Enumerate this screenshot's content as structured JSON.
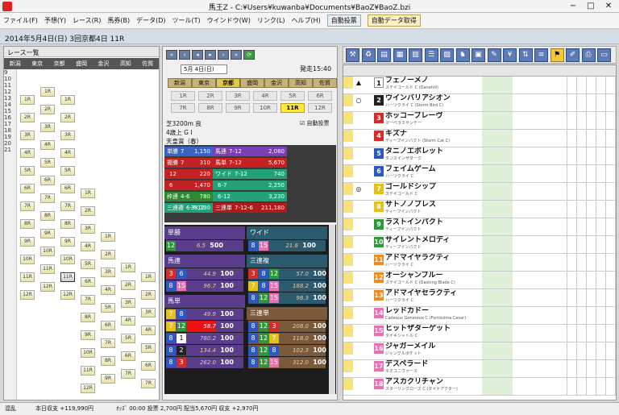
{
  "window": {
    "title": "馬王Z - C:¥Users¥kuwanba¥Documents¥BaoZ¥BaoZ.bzi",
    "min": "−",
    "max": "□",
    "close": "✕"
  },
  "menu": [
    "ファイル(F)",
    "予想(Y)",
    "レース(R)",
    "馬券(B)",
    "データ(D)",
    "ツール(T)",
    "ウインドウ(W)",
    "リンク(L)",
    "ヘルプ(H)"
  ],
  "toolbar": {
    "auto_vote": "自動投票",
    "auto_data": "自動データ取得"
  },
  "date_line": "2014年5月4日(日) 3回京都4日 11R",
  "race_list": {
    "title": "レース一覧",
    "courses": [
      "新潟",
      "東京",
      "京都",
      "盛岡",
      "金沢",
      "高知",
      "佐賀"
    ],
    "hours": [
      "9",
      "10",
      "11",
      "12",
      "13",
      "14",
      "15",
      "16",
      "17",
      "18",
      "19",
      "20",
      "21"
    ]
  },
  "center": {
    "nav": [
      "«",
      "‹",
      "◂",
      "▸",
      "›",
      "»",
      "⟳"
    ],
    "date_select": "5月 4日(日)",
    "time": "発走15:40",
    "tracks": [
      "新潟",
      "東京",
      "京都",
      "盛岡",
      "金沢",
      "高知",
      "佐賀"
    ],
    "races": [
      "1R",
      "2R",
      "3R",
      "4R",
      "5R",
      "6R",
      "7R",
      "8R",
      "9R",
      "10R",
      "11R",
      "12R"
    ],
    "selected_race": "11R",
    "info": [
      "芝3200m 良",
      "4歳上 G I",
      "天皇賞（春）"
    ],
    "auto_vote_label": "☑ 自動投票",
    "odds_grid": [
      {
        "label": "単勝",
        "n": "7",
        "val": "1,150",
        "c": "#3b63c4"
      },
      {
        "label": "馬連",
        "n": "7-12",
        "val": "2,080",
        "c": "#7a3fb2"
      },
      {
        "label": "複勝",
        "n": "7",
        "val": "310",
        "c": "#c42222"
      },
      {
        "label": "馬単",
        "n": "7-12",
        "val": "5,670",
        "c": "#c42222"
      },
      {
        "label": "",
        "n": "12",
        "val": "220",
        "c": "#c42222"
      },
      {
        "label": "ワイド",
        "n": "7-12",
        "val": "740",
        "c": "#23a27a"
      },
      {
        "label": "",
        "n": "6",
        "val": "1,470",
        "c": "#c42222"
      },
      {
        "label": "",
        "n": "6-7",
        "val": "2,250",
        "c": "#23a27a"
      },
      {
        "label": "枠連",
        "n": "4-6",
        "val": "780",
        "c": "#2f8a2f"
      },
      {
        "label": "",
        "n": "6-12",
        "val": "3,230",
        "c": "#23a27a"
      },
      {
        "label": "三連複",
        "n": "6-7-12",
        "val": "38,790",
        "c": "#23a27a"
      },
      {
        "label": "三連単",
        "n": "7-12-6",
        "val": "211,180",
        "c": "#b01a1a"
      }
    ],
    "bets_left": [
      {
        "head": "単勝",
        "rows": [
          {
            "n": [
              "12"
            ],
            "v": "6.5",
            "a": "500"
          }
        ]
      },
      {
        "head": "馬連",
        "rows": [
          {
            "n": [
              "3",
              "6"
            ],
            "v": "44.9",
            "a": "100"
          },
          {
            "n": [
              "8",
              "15"
            ],
            "v": "96.7",
            "a": "100"
          }
        ]
      },
      {
        "head": "馬単",
        "rows": [
          {
            "n": [
              "7",
              "8"
            ],
            "v": "49.9",
            "a": "100"
          },
          {
            "n": [
              "7",
              "12"
            ],
            "v": "58.7",
            "a": "100",
            "hi": true
          },
          {
            "n": [
              "8",
              "1"
            ],
            "v": "780.2",
            "a": "100"
          },
          {
            "n": [
              "8",
              "2"
            ],
            "v": "134.4",
            "a": "100"
          },
          {
            "n": [
              "8",
              "3"
            ],
            "v": "262.0",
            "a": "100"
          }
        ]
      }
    ],
    "bets_right": [
      {
        "head": "ワイド",
        "rows": [
          {
            "n": [
              "8",
              "15"
            ],
            "v": "21.6",
            "a": "100"
          }
        ]
      },
      {
        "head": "三連複",
        "rows": [
          {
            "n": [
              "3",
              "8",
              "12"
            ],
            "v": "57.0",
            "a": "100"
          },
          {
            "n": [
              "7",
              "8",
              "15"
            ],
            "v": "188.2",
            "a": "100"
          },
          {
            "n": [
              "8",
              "12",
              "15"
            ],
            "v": "98.3",
            "a": "100"
          }
        ]
      },
      {
        "head": "三連単",
        "rows": [
          {
            "n": [
              "8",
              "12",
              "3"
            ],
            "v": "208.0",
            "a": "100"
          },
          {
            "n": [
              "8",
              "12",
              "7"
            ],
            "v": "118.0",
            "a": "100"
          },
          {
            "n": [
              "8",
              "12",
              "8"
            ],
            "v": "102.3",
            "a": "100"
          },
          {
            "n": [
              "8",
              "12",
              "15"
            ],
            "v": "312.0",
            "a": "100"
          }
        ]
      }
    ]
  },
  "horses": [
    {
      "n": "1",
      "c": "#ffffff",
      "name": "フェノーメノ",
      "sire": "ステイゴールド C (Danehill)",
      "mark": "▲"
    },
    {
      "n": "2",
      "c": "#222222",
      "name": "ウインバリアシオン",
      "sire": "ハーツクライ C (Storm Bird C)",
      "mark": "○"
    },
    {
      "n": "3",
      "c": "#d52b2b",
      "name": "ホッコーブレーヴ",
      "sire": "マーベラスサンデー",
      "mark": ""
    },
    {
      "n": "4",
      "c": "#d52b2b",
      "name": "キズナ",
      "sire": "ディープインパクト (Storm Cat C)",
      "mark": ""
    },
    {
      "n": "5",
      "c": "#2c58c4",
      "name": "タニノエポレット",
      "sire": "ダンスインザダーク",
      "mark": ""
    },
    {
      "n": "6",
      "c": "#2c58c4",
      "name": "フェイムゲーム",
      "sire": "ハーツクライ C",
      "mark": ""
    },
    {
      "n": "7",
      "c": "#e4c21d",
      "name": "ゴールドシップ",
      "sire": "ステイゴールド C",
      "mark": "◎"
    },
    {
      "n": "8",
      "c": "#e4c21d",
      "name": "サトノノブレス",
      "sire": "ディープインパクト",
      "mark": ""
    },
    {
      "n": "9",
      "c": "#2d9a3a",
      "name": "ラストインパクト",
      "sire": "ディープインパクト",
      "mark": ""
    },
    {
      "n": "10",
      "c": "#2d9a3a",
      "name": "サイレントメロディ",
      "sire": "ディープインパクト",
      "mark": ""
    },
    {
      "n": "11",
      "c": "#f08a1e",
      "name": "アドマイヤラクティ",
      "sire": "ハーツクライ C",
      "mark": ""
    },
    {
      "n": "12",
      "c": "#f08a1e",
      "name": "オーシャンブルー",
      "sire": "ステイゴールド C (Dashing Blade C)",
      "mark": ""
    },
    {
      "n": "13",
      "c": "#f08a1e",
      "name": "アドマイヤセラクティ",
      "sire": "ハーツクライ C",
      "mark": ""
    },
    {
      "n": "14",
      "c": "#ec6fb2",
      "name": "レッドカドー",
      "sire": "Cadeaux Genereux C (Fortissima Cesar)",
      "mark": ""
    },
    {
      "n": "15",
      "c": "#ec6fb2",
      "name": "ヒットザターゲット",
      "sire": "タイキシャトル C",
      "mark": ""
    },
    {
      "n": "16",
      "c": "#ec6fb2",
      "name": "ジャガーメイル",
      "sire": "ジャングルポケット",
      "mark": ""
    },
    {
      "n": "17",
      "c": "#ec6fb2",
      "name": "デスペラード",
      "sire": "ネオユニヴァース",
      "mark": ""
    },
    {
      "n": "18",
      "c": "#ec6fb2",
      "name": "アスカクリチャン",
      "sire": "スターリングローズ C (ダイナアクター)",
      "mark": ""
    }
  ],
  "status": {
    "left": "混乱",
    "income": "本日収支 +119,990円",
    "detail": "ｵｯｽﾞ 00:00 投票 2,700円 配当5,670円 収支 +2,970円"
  }
}
